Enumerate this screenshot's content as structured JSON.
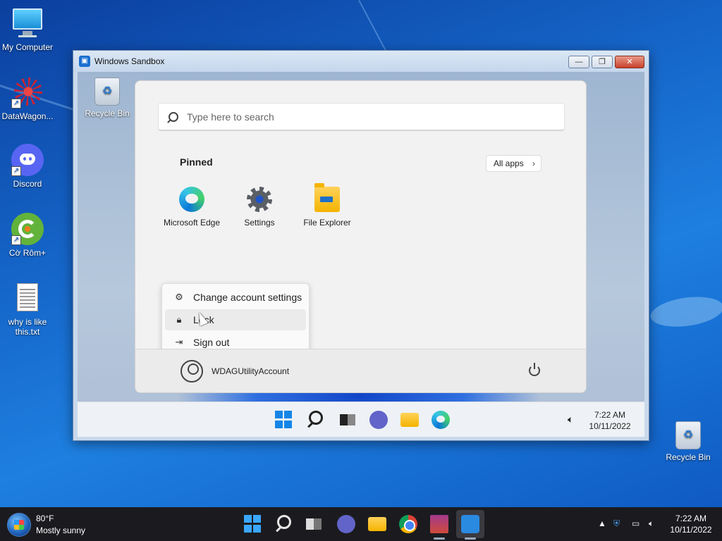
{
  "desktop": {
    "icons": [
      {
        "label": "My Computer"
      },
      {
        "label": "DataWagon..."
      },
      {
        "label": "Discord"
      },
      {
        "label": "Cờ Rôm+"
      },
      {
        "label": "why is like this.txt"
      }
    ],
    "recycle_bin_label": "Recycle Bin"
  },
  "sandbox_window": {
    "title": "Windows Sandbox",
    "minimize_glyph": "—",
    "maximize_glyph": "❐",
    "close_glyph": "✕",
    "desktop": {
      "recycle_bin_label": "Recycle Bin"
    },
    "start_menu": {
      "search_placeholder": "Type here to search",
      "pinned_title": "Pinned",
      "all_apps_label": "All apps",
      "pinned_apps": [
        {
          "label": "Microsoft Edge",
          "icon": "edge-icon"
        },
        {
          "label": "Settings",
          "icon": "gear-icon"
        },
        {
          "label": "File Explorer",
          "icon": "folder-icon"
        }
      ],
      "account_menu": [
        {
          "label": "Change account settings",
          "icon": "account-settings-icon"
        },
        {
          "label": "Lock",
          "icon": "lock-icon"
        },
        {
          "label": "Sign out",
          "icon": "sign-out-icon"
        }
      ],
      "user_name": "WDAGUtilityAccount"
    },
    "taskbar": {
      "time": "7:22 AM",
      "date": "10/11/2022"
    }
  },
  "host_taskbar": {
    "weather_temp": "80°F",
    "weather_desc": "Mostly sunny",
    "time": "7:22 AM",
    "date": "10/11/2022"
  }
}
